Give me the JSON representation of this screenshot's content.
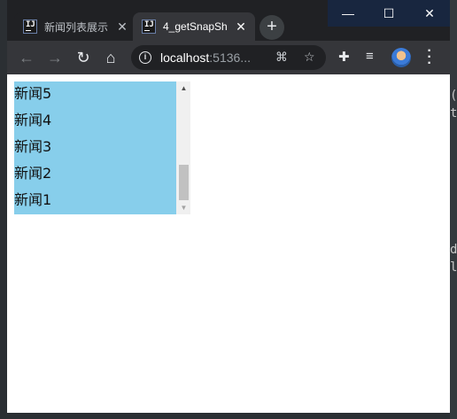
{
  "browser": {
    "tabs": [
      {
        "title": "新闻列表展示",
        "close": "✕",
        "active": false
      },
      {
        "title": "4_getSnapSh",
        "close": "✕",
        "active": true
      }
    ],
    "new_tab": "+",
    "window_controls": {
      "minimize": "—",
      "maximize": "☐",
      "close": "✕"
    },
    "nav": {
      "back": "←",
      "forward": "→",
      "reload": "↻",
      "home": "⌂"
    },
    "address": {
      "host": "localhost",
      "port": ":5136..."
    },
    "icons": [
      "info-icon",
      "translate-icon",
      "bookmark-star-icon",
      "extensions-icon",
      "reading-list-icon",
      "profile-avatar",
      "menu-icon"
    ]
  },
  "page": {
    "news_list": [
      "新闻5",
      "新闻4",
      "新闻3",
      "新闻2",
      "新闻1"
    ],
    "colors": {
      "list_background": "#87ceeb",
      "scrollbar_track": "#f0f0f0",
      "scrollbar_thumb": "#c1c1c1"
    }
  },
  "desktop_glyphs": [
    "(",
    "t",
    "d",
    "l"
  ]
}
